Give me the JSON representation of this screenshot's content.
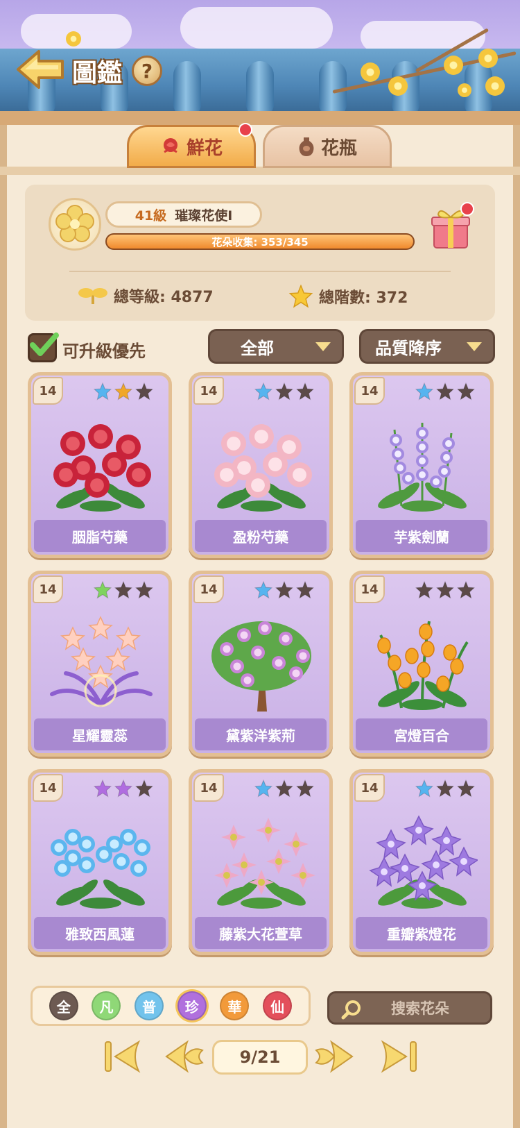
{
  "header": {
    "title": "圖鑑",
    "help": "?"
  },
  "tabs": [
    {
      "label": "鮮花",
      "active": true,
      "has_badge": true
    },
    {
      "label": "花瓶",
      "active": false,
      "has_badge": false
    }
  ],
  "summary": {
    "level": "41級",
    "rank_title": "璀璨花使I",
    "collection_text": "花朵收集: 353/345",
    "collection_progress": 1.0,
    "total_level": "總等級: 4877",
    "total_tier": "總階數: 372"
  },
  "filters": {
    "upgradable_first_label": "可升級優先",
    "upgradable_first_checked": true,
    "category": "全部",
    "sort": "品質降序"
  },
  "flowers": [
    {
      "level": "14",
      "name": "胭脂芍藥",
      "stars": [
        "#56b4ef",
        "#f0a72a",
        "#5c4a48"
      ],
      "art": "peony-red"
    },
    {
      "level": "14",
      "name": "盈粉芍藥",
      "stars": [
        "#56b4ef",
        "#5c4a48",
        "#5c4a48"
      ],
      "art": "peony-pink"
    },
    {
      "level": "14",
      "name": "芋紫劍蘭",
      "stars": [
        "#56b4ef",
        "#5c4a48",
        "#5c4a48"
      ],
      "art": "gladiolus"
    },
    {
      "level": "14",
      "name": "星耀靈蕊",
      "stars": [
        "#7fd35e",
        "#5c4a48",
        "#5c4a48"
      ],
      "art": "star-flower"
    },
    {
      "level": "14",
      "name": "黛紫洋紫荊",
      "stars": [
        "#56b4ef",
        "#5c4a48",
        "#5c4a48"
      ],
      "art": "tree"
    },
    {
      "level": "14",
      "name": "宮燈百合",
      "stars": [
        "#5c4a48",
        "#5c4a48",
        "#5c4a48"
      ],
      "art": "lantern-lily"
    },
    {
      "level": "14",
      "name": "雅致西風蓮",
      "stars": [
        "#b06de0",
        "#b06de0",
        "#5c4a48"
      ],
      "art": "blue-flower"
    },
    {
      "level": "14",
      "name": "藤紫大花萱草",
      "stars": [
        "#56b4ef",
        "#5c4a48",
        "#5c4a48"
      ],
      "art": "daylily"
    },
    {
      "level": "14",
      "name": "重瓣紫燈花",
      "stars": [
        "#56b4ef",
        "#5c4a48",
        "#5c4a48"
      ],
      "art": "purple-bell"
    }
  ],
  "rarity": [
    {
      "label": "全",
      "color": "#6d5a52",
      "selected": false
    },
    {
      "label": "凡",
      "color": "#8fd877",
      "selected": false
    },
    {
      "label": "普",
      "color": "#72c3ec",
      "selected": false
    },
    {
      "label": "珍",
      "color": "#b070dd",
      "selected": true
    },
    {
      "label": "華",
      "color": "#f29a3a",
      "selected": false
    },
    {
      "label": "仙",
      "color": "#e34f5b",
      "selected": false
    }
  ],
  "search": {
    "placeholder": "搜索花朵"
  },
  "pager": {
    "page": "9/21"
  }
}
